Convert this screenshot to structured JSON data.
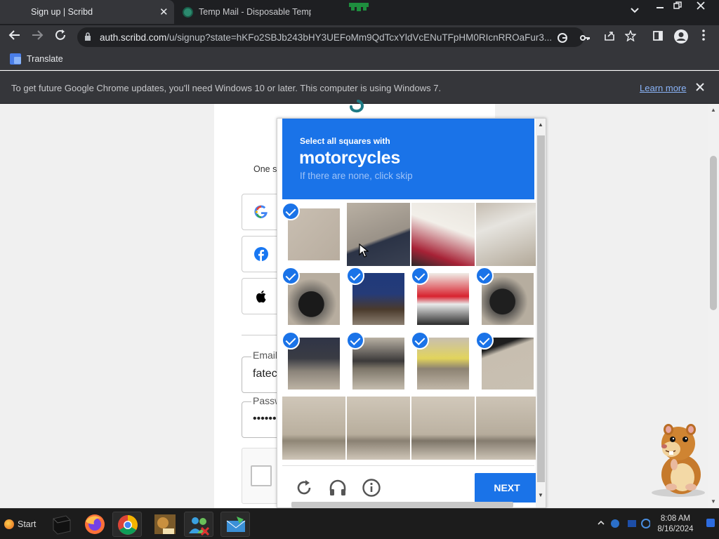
{
  "browser": {
    "tabs": [
      {
        "title": "Sign up | Scribd",
        "active": true
      },
      {
        "title": "Temp Mail - Disposable Temp",
        "active": false
      }
    ],
    "close_glyph": "✕",
    "url_host": "auth.scribd.com",
    "url_rest": "/u/signup?state=hKFo2SBJb243bHY3UEFoMm9QdTcxYldVcENuTFpHM0RIcnRROaFur3...",
    "bookmarks": [
      {
        "label": "Translate",
        "icon": "google-translate-icon"
      }
    ],
    "infobar": {
      "message": "To get future Google Chrome updates, you'll need Windows 10 or later. This computer is using Windows 7.",
      "link": "Learn more"
    }
  },
  "signup": {
    "tagline_partial": "One s",
    "social_buttons": [
      "google-icon",
      "facebook-icon",
      "apple-icon"
    ],
    "email_label": "Email",
    "email_value": "fatec",
    "password_label": "Passw",
    "password_value": "•••••••"
  },
  "captcha": {
    "instruction": "Select all squares with",
    "target": "motorcycles",
    "hint": "If there are none, click skip",
    "next_label": "NEXT",
    "selected": [
      true,
      false,
      false,
      false,
      true,
      true,
      true,
      true,
      true,
      true,
      true,
      true,
      false,
      false,
      false,
      false
    ],
    "footer_icons": [
      "reload-icon",
      "audio-icon",
      "info-icon"
    ]
  },
  "taskbar": {
    "start_label": "Start",
    "time": "8:08 AM",
    "date": "8/16/2024"
  },
  "colors": {
    "captcha_blue": "#1a73e8",
    "chrome_dark": "#35363a",
    "link_blue": "#8ab4f8"
  }
}
